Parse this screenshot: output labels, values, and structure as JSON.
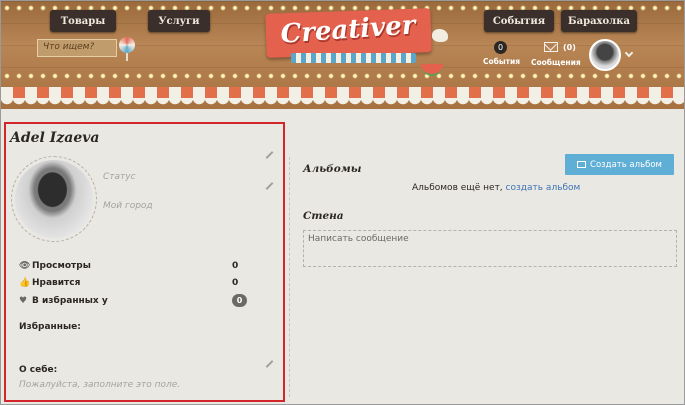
{
  "header": {
    "nav_left": [
      "Товары",
      "Услуги"
    ],
    "nav_right": [
      "События",
      "Барахолка"
    ],
    "search_placeholder": "Что ищем?",
    "logo": "Creativer",
    "events_count": "0",
    "events_label": "События",
    "messages_count": "(0)",
    "messages_label": "Сообщения"
  },
  "profile": {
    "name": "Adel Izaeva",
    "status_placeholder": "Статус",
    "city_placeholder": "Мой город",
    "stats": [
      {
        "icon": "eye-icon",
        "label": "Просмотры",
        "value": "0"
      },
      {
        "icon": "thumbs-up-icon",
        "label": "Нравится",
        "value": "0"
      },
      {
        "icon": "heart-icon",
        "label": "В избранных у",
        "value": "0"
      }
    ],
    "favorites_label": "Избранные:",
    "about_label": "О себе:",
    "about_placeholder": "Пожалуйста, заполните это поле."
  },
  "main": {
    "albums_title": "Альбомы",
    "create_album_label": "Создать альбом",
    "albums_empty_text": "Альбомов ещё нет,",
    "albums_empty_link": "создать альбом",
    "wall_title": "Стена",
    "wall_placeholder": "Написать сообщение"
  },
  "colors": {
    "accent_red": "#d3262a",
    "button_blue": "#5faed6",
    "link_blue": "#3e74b4",
    "logo_red": "#e4614e"
  }
}
